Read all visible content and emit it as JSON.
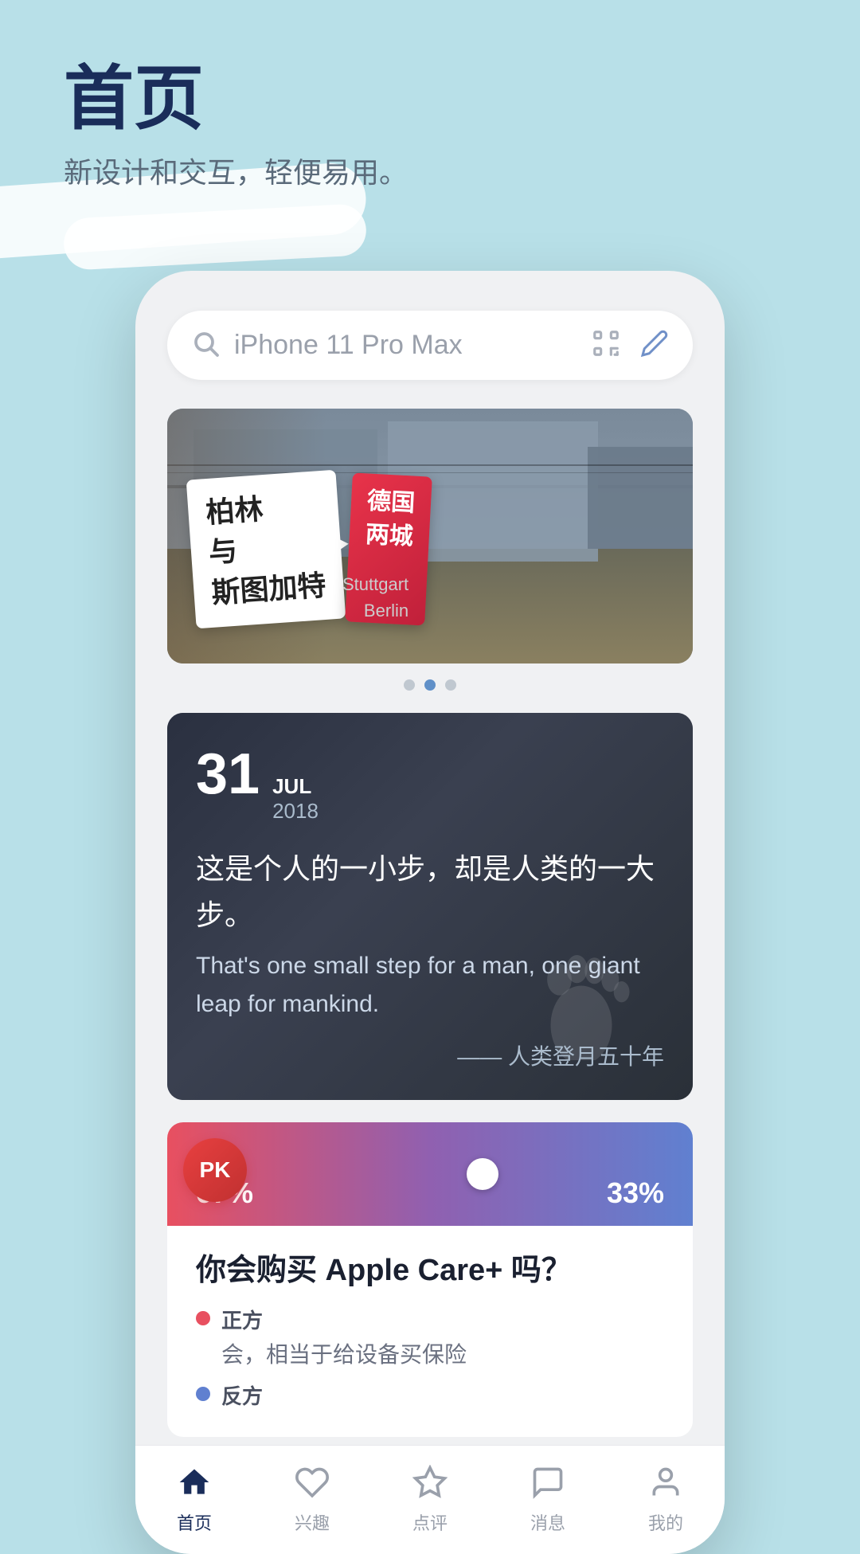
{
  "page": {
    "title": "首页",
    "subtitle": "新设计和交互，轻便易用。",
    "bg_color": "#b8e0e8"
  },
  "search": {
    "placeholder": "iPhone 11 Pro Max",
    "icons": {
      "search": "search-icon",
      "scan": "scan-icon",
      "edit": "edit-icon"
    }
  },
  "banner": {
    "white_card_line1": "柏林",
    "white_card_line2": "与",
    "white_card_line3": "斯图加特",
    "red_card_line1": "德国",
    "red_card_line2": "两城",
    "sub_text_line1": "Stuttgart",
    "sub_text_line2": "Berlin"
  },
  "dots": [
    {
      "active": false
    },
    {
      "active": true
    },
    {
      "active": false
    }
  ],
  "quote": {
    "day": "31",
    "month": "JUL",
    "year": "2018",
    "text_cn": "这是个人的一小步，却是人类的一大步。",
    "text_en": "That's one small step for a man, one giant leap for mankind.",
    "source": "—— 人类登月五十年"
  },
  "pk": {
    "badge": "PK",
    "percent_left": "67%",
    "percent_right": "33%",
    "question": "你会购买 Apple Care+ 吗？",
    "sides": [
      {
        "color": "red",
        "label": "正方",
        "desc": "会，相当于给设备买保险"
      },
      {
        "color": "blue",
        "label": "反方",
        "desc": ""
      }
    ]
  },
  "tabs": [
    {
      "label": "首页",
      "icon": "home-icon",
      "active": true
    },
    {
      "label": "兴趣",
      "icon": "heart-icon",
      "active": false
    },
    {
      "label": "点评",
      "icon": "star-icon",
      "active": false
    },
    {
      "label": "消息",
      "icon": "message-icon",
      "active": false
    },
    {
      "label": "我的",
      "icon": "user-icon",
      "active": false
    }
  ]
}
